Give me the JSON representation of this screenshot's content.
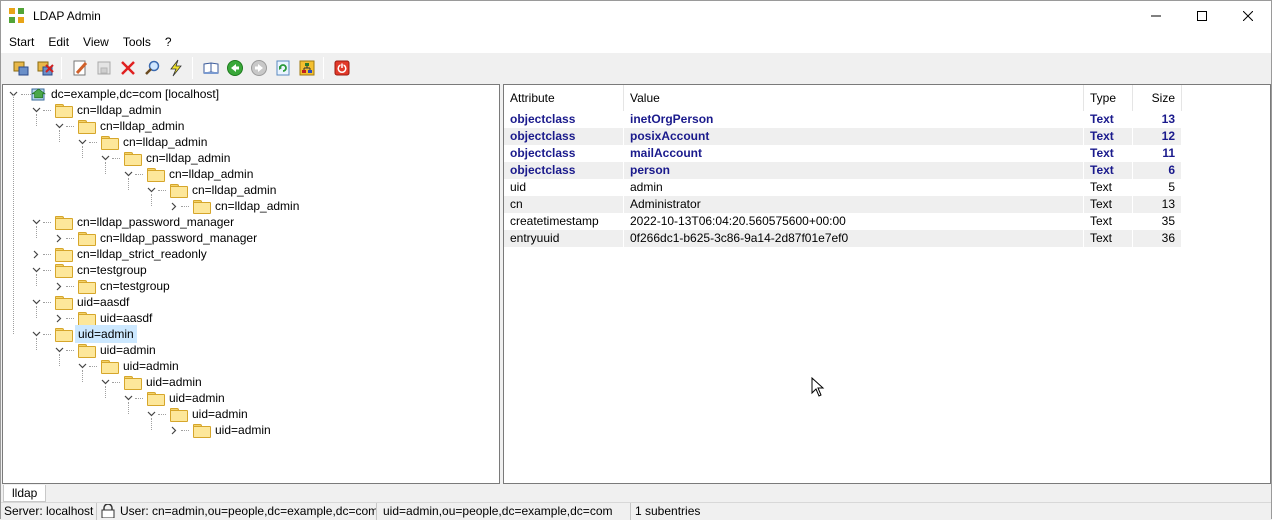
{
  "window": {
    "title": "LDAP Admin"
  },
  "menu": {
    "start": "Start",
    "edit": "Edit",
    "view": "View",
    "tools": "Tools",
    "help": "?"
  },
  "toolbar": {
    "icons": [
      "connect-icon",
      "disconnect-icon",
      "edit-entry-icon",
      "save-icon",
      "delete-icon",
      "search-icon",
      "lightning-icon",
      "book-icon",
      "back-icon",
      "forward-icon",
      "refresh-icon",
      "tree-icon",
      "exit-icon"
    ]
  },
  "tree": {
    "root": "dc=example,dc=com [localhost]",
    "nodes": [
      {
        "label": "cn=lldap_admin",
        "depth": 1,
        "expander": "open"
      },
      {
        "label": "cn=lldap_admin",
        "depth": 2,
        "expander": "open"
      },
      {
        "label": "cn=lldap_admin",
        "depth": 3,
        "expander": "open"
      },
      {
        "label": "cn=lldap_admin",
        "depth": 4,
        "expander": "open"
      },
      {
        "label": "cn=lldap_admin",
        "depth": 5,
        "expander": "open"
      },
      {
        "label": "cn=lldap_admin",
        "depth": 6,
        "expander": "open"
      },
      {
        "label": "cn=lldap_admin",
        "depth": 7,
        "expander": "closed"
      },
      {
        "label": "cn=lldap_password_manager",
        "depth": 1,
        "expander": "open"
      },
      {
        "label": "cn=lldap_password_manager",
        "depth": 2,
        "expander": "closed"
      },
      {
        "label": "cn=lldap_strict_readonly",
        "depth": 1,
        "expander": "closed"
      },
      {
        "label": "cn=testgroup",
        "depth": 1,
        "expander": "open"
      },
      {
        "label": "cn=testgroup",
        "depth": 2,
        "expander": "closed"
      },
      {
        "label": "uid=aasdf",
        "depth": 1,
        "expander": "open"
      },
      {
        "label": "uid=aasdf",
        "depth": 2,
        "expander": "closed"
      },
      {
        "label": "uid=admin",
        "depth": 1,
        "expander": "open",
        "selected": true
      },
      {
        "label": "uid=admin",
        "depth": 2,
        "expander": "open"
      },
      {
        "label": "uid=admin",
        "depth": 3,
        "expander": "open"
      },
      {
        "label": "uid=admin",
        "depth": 4,
        "expander": "open"
      },
      {
        "label": "uid=admin",
        "depth": 5,
        "expander": "open"
      },
      {
        "label": "uid=admin",
        "depth": 6,
        "expander": "open"
      },
      {
        "label": "uid=admin",
        "depth": 7,
        "expander": "closed"
      }
    ]
  },
  "attributes": {
    "columns": [
      "Attribute",
      "Value",
      "Type",
      "Size"
    ],
    "rows": [
      {
        "attribute": "objectclass",
        "value": "inetOrgPerson",
        "type": "Text",
        "size": "13",
        "bold": true
      },
      {
        "attribute": "objectclass",
        "value": "posixAccount",
        "type": "Text",
        "size": "12",
        "bold": true
      },
      {
        "attribute": "objectclass",
        "value": "mailAccount",
        "type": "Text",
        "size": "11",
        "bold": true
      },
      {
        "attribute": "objectclass",
        "value": "person",
        "type": "Text",
        "size": "6",
        "bold": true
      },
      {
        "attribute": "uid",
        "value": "admin",
        "type": "Text",
        "size": "5",
        "bold": false
      },
      {
        "attribute": "cn",
        "value": "Administrator",
        "type": "Text",
        "size": "13",
        "bold": false
      },
      {
        "attribute": "createtimestamp",
        "value": "2022-10-13T06:04:20.560575600+00:00",
        "type": "Text",
        "size": "35",
        "bold": false
      },
      {
        "attribute": "entryuuid",
        "value": "0f266dc1-b625-3c86-9a14-2d87f01e7ef0",
        "type": "Text",
        "size": "36",
        "bold": false
      }
    ]
  },
  "tabs": {
    "active": "lldap"
  },
  "status": {
    "server": "Server: localhost",
    "user": "User: cn=admin,ou=people,dc=example,dc=com",
    "dn": "uid=admin,ou=people,dc=example,dc=com",
    "subentries": "1 subentries"
  },
  "colors": {
    "bold_text": "#1a1a8c",
    "selection": "#cce8ff",
    "alt_row": "#efefef"
  }
}
